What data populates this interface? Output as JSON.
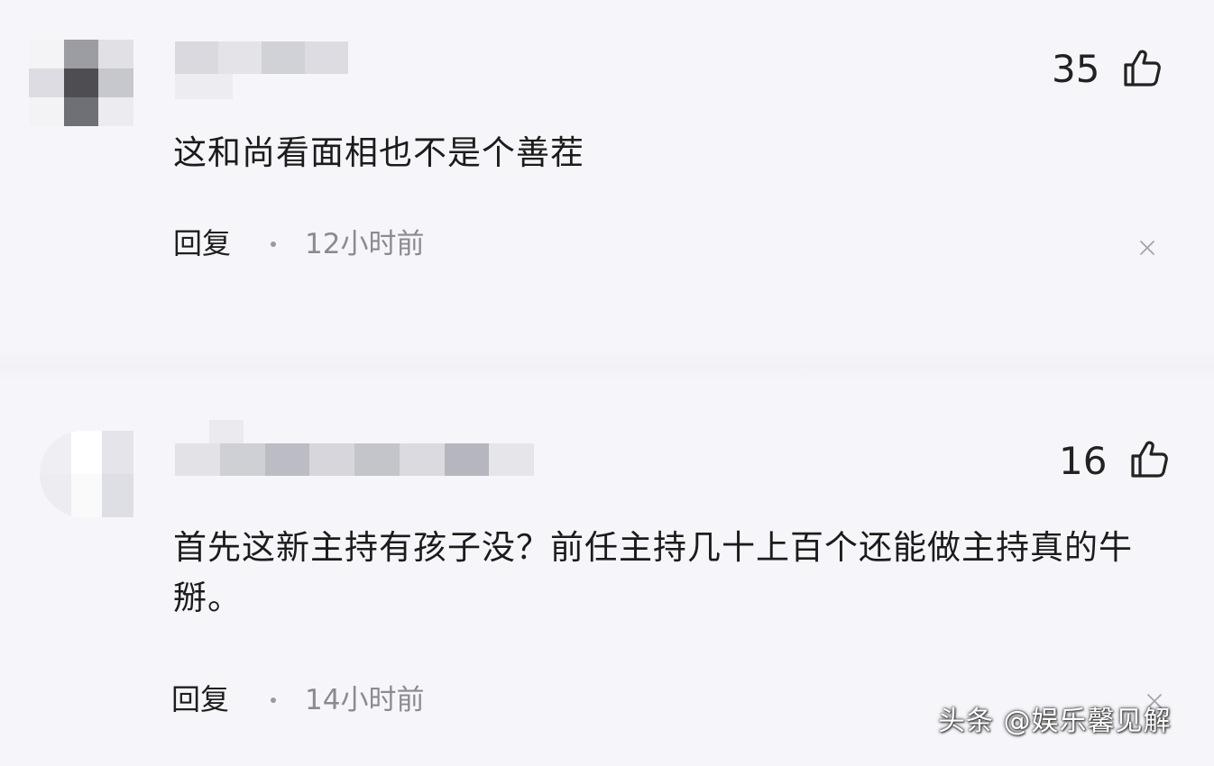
{
  "comments": [
    {
      "likes": "35",
      "text": "这和尚看面相也不是个善茬",
      "reply_label": "回复",
      "separator": "·",
      "time": "12小时前"
    },
    {
      "likes": "16",
      "text": "首先这新主持有孩子没？前任主持几十上百个还能做主持真的牛掰。",
      "reply_label": "回复",
      "separator": "·",
      "time": "14小时前"
    }
  ],
  "watermark": "头条 @娱乐馨见解",
  "icons": {
    "like": "thumbs-up-icon",
    "close": "close-icon"
  },
  "colors": {
    "background": "#f6f6fa",
    "text": "#1b1b1b",
    "muted": "#8a8a90"
  }
}
